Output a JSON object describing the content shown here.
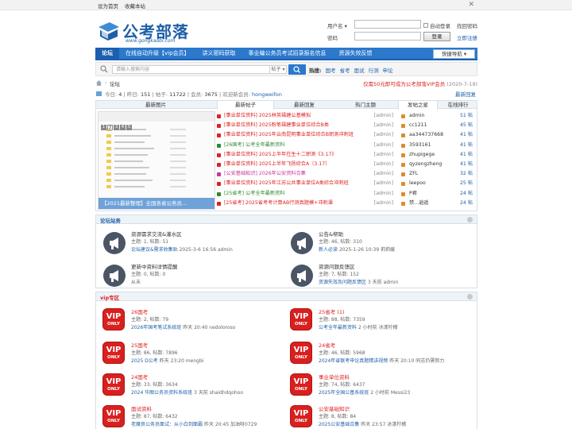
{
  "topbar": {
    "links": [
      "设为首页",
      "收藏本站"
    ],
    "close": "✕"
  },
  "logo": {
    "name": "公考部落",
    "url": "www.gongkaobl.com"
  },
  "login": {
    "user_label": "用户名",
    "user_select": "▾",
    "auto_login": "自动登录",
    "find_password": "找回密码",
    "password_label": "密码",
    "login_button": "登录",
    "register": "立即注册"
  },
  "nav": {
    "items": [
      "论坛",
      "在线自动升级【vip会员】",
      "讲义密码获取",
      "事业编公务员考试招录报名信息",
      "资源失效反馈"
    ],
    "quick": "快捷导航 ▾"
  },
  "search": {
    "placeholder": "请输入搜索内容",
    "scope": "帖子 ▾",
    "hot_label": "热搜:",
    "hot": [
      "国考",
      "省考",
      "面试",
      "行测",
      "申论"
    ]
  },
  "breadcrumb": {
    "current": "论坛",
    "notice_highlight": "仅需50元即可成为公考部落VIP会员",
    "notice_date": "(2020-7-19)"
  },
  "stats": {
    "today_label": "今日:",
    "today": "4",
    "yesterday_label": "昨日:",
    "yesterday": "151",
    "posts_label": "帖子:",
    "posts": "11722",
    "members_label": "会员:",
    "members": "3675",
    "welcome_label": "欢迎新会员:",
    "new_member": "hongweifon",
    "latest": "最新回复"
  },
  "tabs": {
    "images": "最新图片",
    "new_posts": "最新帖子",
    "new_replies": "最新回复",
    "hot": "热门主题",
    "post_rank": "发帖之星",
    "online_rank": "在线排行"
  },
  "slide": {
    "caption": "【2021最新整理】全国各省公务员...",
    "pages": [
      "1",
      "2",
      "3",
      "4",
      "5"
    ]
  },
  "threads": [
    {
      "title": "[事业单位资料] 2025林英福建公基模拟",
      "user": "[admin]",
      "color": "#d22"
    },
    {
      "title": "[事业单位资料] 2025粉笔福建事业单位综合B类",
      "user": "[admin]",
      "color": "#d22"
    },
    {
      "title": "[事业单位资料] 2025年云南昆明事业单位综合B职测冲刺班",
      "user": "[admin]",
      "color": "#d22"
    },
    {
      "title": "[26国考] 公考全年最新资料",
      "user": "[admin]",
      "color": "#2e8b2e"
    },
    {
      "title": "[事业单位资料] 2025上半年在生十二职测《3.17》",
      "user": "[admin]",
      "color": "#d22"
    },
    {
      "title": "[事业单位资料] 2025上半年飞扬综合A（3.17）",
      "user": "[admin]",
      "color": "#d22"
    },
    {
      "title": "[公安基础知识] 2026年公安资料合集",
      "user": "[admin]",
      "color": "#c8359d"
    },
    {
      "title": "[事业单位资料] 2025年江苏公共事业单位A类综合冲刺班",
      "user": "[admin]",
      "color": "#d22"
    },
    {
      "title": "[25省考] 公考全年最新资料",
      "user": "[admin]",
      "color": "#2e8b2e"
    },
    {
      "title": "[25省考] 2025省考考计算AB行测真题模+冲刺课",
      "user": "[admin]",
      "color": "#d22"
    }
  ],
  "post_stars": [
    {
      "name": "admin",
      "count": "51 帖"
    },
    {
      "name": "cc1211",
      "count": "45 帖"
    },
    {
      "name": "aa344737668",
      "count": "41 帖"
    },
    {
      "name": "3593161",
      "count": "41 帖"
    },
    {
      "name": "zhupigege",
      "count": "41 帖"
    },
    {
      "name": "qyzengzheng",
      "count": "41 帖"
    },
    {
      "name": "ZFL",
      "count": "32 帖"
    },
    {
      "name": "leepoo",
      "count": "25 帖"
    },
    {
      "name": "P君",
      "count": "24 帖"
    },
    {
      "name": "禁...逍遥",
      "count": "24 帖"
    }
  ],
  "forum_section": {
    "title": "论坛站务",
    "forums": [
      {
        "name": "资源需求交流&灌水区",
        "today": "",
        "meta": "主题: 1, 帖数: 51",
        "last_link": "论坛建议&需求收集贴",
        "last_info": "2025-3-6 16:56 admin"
      },
      {
        "name": "公告&帮助",
        "today": "",
        "meta": "主题: 46, 帖数: 310",
        "last_link": "新人必读",
        "last_info": "2025-1-26 10:39 莉莉媛"
      },
      {
        "name": "更新中资料详情提醒",
        "today": "",
        "meta": "主题: 0, 帖数: 0",
        "last_link": "",
        "last_info": "从未"
      },
      {
        "name": "资源问题反馈区",
        "today": "",
        "meta": "主题: 7, 帖数: 152",
        "last_link": "资源失效及问题反馈区",
        "last_info": "3 天前 admin"
      }
    ]
  },
  "vip_section": {
    "title": "vip专区",
    "badge_top": "VIP",
    "badge_bottom": "ONLY",
    "forums": [
      {
        "name": "26国考",
        "today": "",
        "meta": "主题: 2, 帖数: 79",
        "last_link": "2026年国考笔试系统班",
        "last_info": "昨天 20:40 nedoloroso"
      },
      {
        "name": "25省考",
        "today": "(1)",
        "meta": "主题: 88, 帖数: 7359",
        "last_link": "公考全年最新资料",
        "last_info": "2 小时前 冰漾柠檬"
      },
      {
        "name": "25国考",
        "today": "",
        "meta": "主题: 86, 帖数: 7896",
        "last_link": "2025 D公考",
        "last_info": "昨天 23:20 mengbi"
      },
      {
        "name": "24省考",
        "today": "",
        "meta": "主题: 46, 帖数: 5968",
        "last_link": "2024年省联考申论真题精讲视频",
        "last_info": "昨天 20:10 同志仍需努力"
      },
      {
        "name": "24国考",
        "today": "",
        "meta": "主题: 33, 帖数: 3634",
        "last_link": "2024 华图公务员资料系统班",
        "last_info": "3 天前 shaidhdqohoo"
      },
      {
        "name": "事业单位资料",
        "today": "",
        "meta": "主题: 74, 帖数: 6437",
        "last_link": "2025年全国公基系统班",
        "last_info": "2 小时前 Messi23"
      },
      {
        "name": "面试资料",
        "today": "",
        "meta": "主题: 87, 帖数: 6432",
        "last_link": "老魔良公务员面试：从小白到面霸",
        "last_info": "昨天 20:45 加油呀0729"
      },
      {
        "name": "公安基础知识",
        "today": "",
        "meta": "主题: 8, 帖数: 84",
        "last_link": "2025公安基础合集",
        "last_info": "昨天 23:57 冰漾柠檬"
      }
    ]
  }
}
